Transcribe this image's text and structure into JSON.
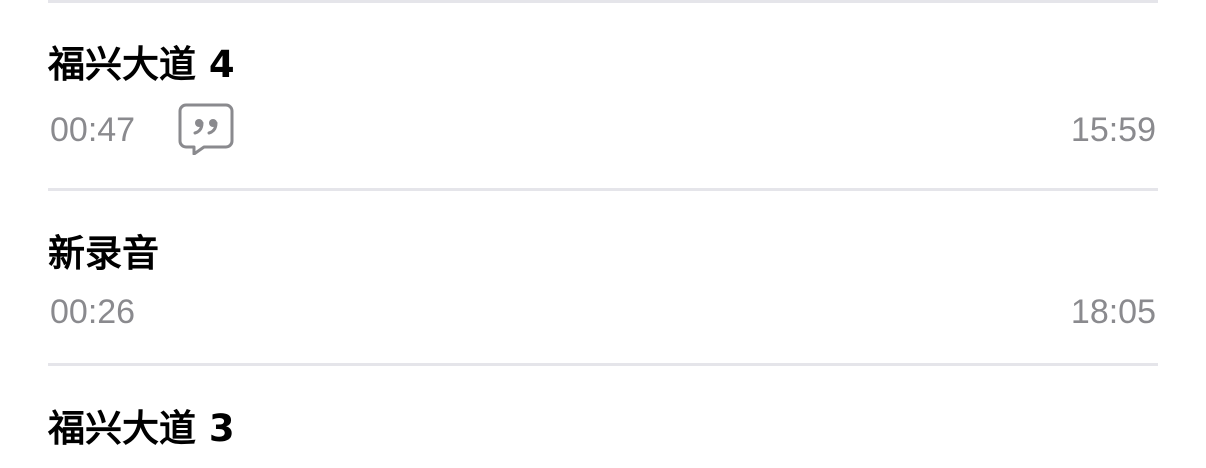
{
  "recordings": [
    {
      "title": "福兴大道 4",
      "duration": "00:47",
      "time": "15:59",
      "has_transcript": true
    },
    {
      "title": "新录音",
      "duration": "00:26",
      "time": "18:05",
      "has_transcript": false
    },
    {
      "title": "福兴大道 3"
    }
  ],
  "icons": {
    "transcript": "quote-bubble-icon"
  },
  "colors": {
    "title": "#000000",
    "secondary": "#8a8a8e",
    "divider": "#e5e5ea"
  }
}
